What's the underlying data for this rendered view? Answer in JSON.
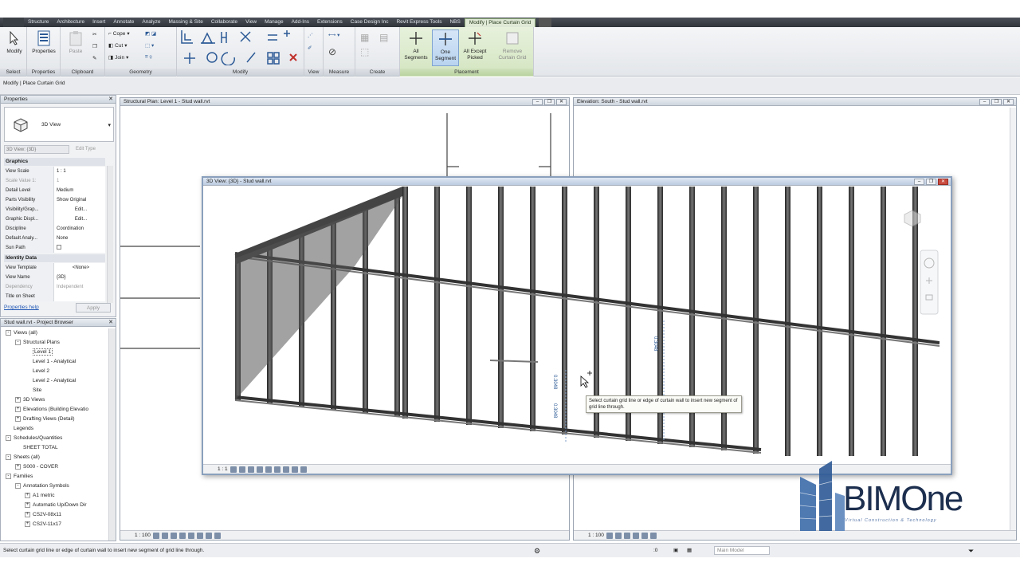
{
  "tabs": [
    "Structure",
    "Architecture",
    "Insert",
    "Annotate",
    "Analyze",
    "Massing & Site",
    "Collaborate",
    "View",
    "Manage",
    "Add-Ins",
    "Extensions",
    "Case Design Inc",
    "Revit Express Tools",
    "NBS",
    "Modify | Place Curtain Grid"
  ],
  "ribbon": {
    "modify": "Modify",
    "properties": "Properties",
    "paste": "Paste",
    "cope": "Cope",
    "cut": "Cut",
    "join": "Join",
    "panels": {
      "select": "Select",
      "properties": "Properties",
      "clipboard": "Clipboard",
      "geometry": "Geometry",
      "modify": "Modify",
      "view": "View",
      "measure": "Measure",
      "create": "Create",
      "placement": "Placement"
    },
    "all_segments": "All Segments",
    "one_segment": "One Segment",
    "all_except_picked": "All Except Picked",
    "remove_curtain_grid": "Remove Curtain Grid"
  },
  "context_bar": "Modify | Place Curtain Grid",
  "properties": {
    "title": "Properties",
    "type_name": "3D View",
    "selector": "3D View: {3D}",
    "edit_type": "Edit Type",
    "sections": {
      "graphics": "Graphics",
      "identity": "Identity Data"
    },
    "rows": [
      {
        "k": "View Scale",
        "v": "1 : 1"
      },
      {
        "k": "Scale Value   1:",
        "v": "1"
      },
      {
        "k": "Detail Level",
        "v": "Medium"
      },
      {
        "k": "Parts Visibility",
        "v": "Show Original"
      },
      {
        "k": "Visibility/Grap...",
        "v": "Edit..."
      },
      {
        "k": "Graphic Displ...",
        "v": "Edit..."
      },
      {
        "k": "Discipline",
        "v": "Coordination"
      },
      {
        "k": "Default Analy...",
        "v": "None"
      },
      {
        "k": "Sun Path",
        "v": ""
      }
    ],
    "identity_rows": [
      {
        "k": "View Template",
        "v": "<None>"
      },
      {
        "k": "View Name",
        "v": "{3D}"
      },
      {
        "k": "Dependency",
        "v": "Independent"
      },
      {
        "k": "Title on Sheet",
        "v": ""
      }
    ],
    "help": "Properties help",
    "apply": "Apply"
  },
  "browser": {
    "title": "Stud wall.rvt - Project Browser",
    "items": [
      {
        "label": "Views (all)",
        "indent": 0,
        "toggle": "-"
      },
      {
        "label": "Structural Plans",
        "indent": 1,
        "toggle": "-"
      },
      {
        "label": "Level 1",
        "indent": 2,
        "toggle": ""
      },
      {
        "label": "Level 1 - Analytical",
        "indent": 2,
        "toggle": ""
      },
      {
        "label": "Level 2",
        "indent": 2,
        "toggle": ""
      },
      {
        "label": "Level 2 - Analytical",
        "indent": 2,
        "toggle": ""
      },
      {
        "label": "Site",
        "indent": 2,
        "toggle": ""
      },
      {
        "label": "3D Views",
        "indent": 1,
        "toggle": "+"
      },
      {
        "label": "Elevations (Building Elevatio",
        "indent": 1,
        "toggle": "+"
      },
      {
        "label": "Drafting Views (Detail)",
        "indent": 1,
        "toggle": "+"
      },
      {
        "label": "Legends",
        "indent": 0,
        "toggle": ""
      },
      {
        "label": "Schedules/Quantities",
        "indent": 0,
        "toggle": "-"
      },
      {
        "label": "SHEET TOTAL",
        "indent": 1,
        "toggle": ""
      },
      {
        "label": "Sheets (all)",
        "indent": 0,
        "toggle": "-"
      },
      {
        "label": "S000 - COVER",
        "indent": 1,
        "toggle": "+"
      },
      {
        "label": "Families",
        "indent": 0,
        "toggle": "-"
      },
      {
        "label": "Annotation Symbols",
        "indent": 1,
        "toggle": "-"
      },
      {
        "label": "A1 metric",
        "indent": 2,
        "toggle": "+"
      },
      {
        "label": "Automatic Up/Down Dir",
        "indent": 2,
        "toggle": "+"
      },
      {
        "label": "CS2V-08x11",
        "indent": 2,
        "toggle": "+"
      },
      {
        "label": "CS2V-11x17",
        "indent": 2,
        "toggle": "+"
      }
    ]
  },
  "views": {
    "plan_title": "Structural Plan: Level 1 - Stud wall.rvt",
    "elev_title": "Elevation: South - Stud wall.rvt",
    "threed_title": "3D View: {3D} - Stud wall.rvt",
    "plan_scale": "1 : 100",
    "elev_scale": "1 : 100",
    "threed_scale": "1 : 1"
  },
  "tooltip": "Select curtain grid line or edge of curtain wall to insert new segment of grid line through.",
  "dims": {
    "d1": "0.3048",
    "d2": "0.3048",
    "d3": "0.3048"
  },
  "logo": {
    "text": "BIMOne",
    "sub": "Virtual Construction & Technology"
  },
  "status": {
    "message": "Select curtain grid line or edge of curtain wall to insert new segment of grid line through.",
    "model": "Main Model",
    "zero": ":0"
  }
}
